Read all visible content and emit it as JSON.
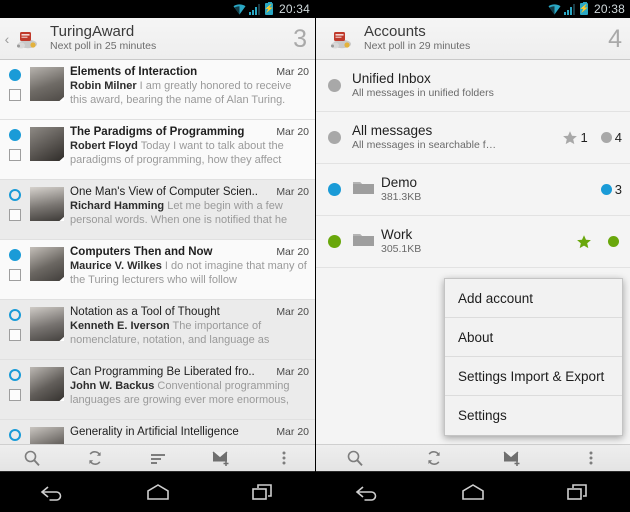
{
  "left": {
    "statusbar": {
      "time": "20:34",
      "wifi_icon": "wifi-icon",
      "signal_icon": "signal-icon",
      "battery_icon": "battery-charging-icon"
    },
    "actionbar": {
      "back_icon": "back-chevron-icon",
      "app_icon": "k9-mail-dog-icon",
      "title": "TuringAward",
      "subtitle": "Next poll in 25 minutes",
      "count": "3"
    },
    "messages": [
      {
        "subject": "Elements of Interaction",
        "date": "Mar 20",
        "sender": "Robin Milner",
        "preview": "I am greatly honored to receive this award, bearing the name of Alan Turing.",
        "unread": true
      },
      {
        "subject": "The Paradigms of Programming",
        "date": "Mar 20",
        "sender": "Robert Floyd",
        "preview": "Today I want to talk about the paradigms of programming, how they affect",
        "unread": true
      },
      {
        "subject": "One Man's View of Computer Scien..",
        "date": "Mar 20",
        "sender": "Richard Hamming",
        "preview": "Let me begin with a few personal words. When one is notified that he",
        "unread": false
      },
      {
        "subject": "Computers Then and Now",
        "date": "Mar 20",
        "sender": "Maurice V. Wilkes",
        "preview": "I do not imagine that many of the Turing lecturers who will follow",
        "unread": true
      },
      {
        "subject": "Notation as a Tool of Thought",
        "date": "Mar 20",
        "sender": "Kenneth E. Iverson",
        "preview": "The importance of nomenclature, notation, and language as",
        "unread": false
      },
      {
        "subject": "Can Programming Be Liberated fro..",
        "date": "Mar 20",
        "sender": "John W. Backus",
        "preview": "Conventional programming languages are growing ever more enormous,",
        "unread": false
      },
      {
        "subject": "Generality in Artificial Intelligence",
        "date": "Mar 20",
        "sender": "",
        "preview": "",
        "unread": false
      }
    ],
    "toolbar": [
      {
        "icon": "search-icon",
        "label": "Search"
      },
      {
        "icon": "refresh-icon",
        "label": "Refresh"
      },
      {
        "icon": "sort-icon",
        "label": "Sort"
      },
      {
        "icon": "compose-icon",
        "label": "Compose"
      },
      {
        "icon": "overflow-menu-icon",
        "label": "More options"
      }
    ]
  },
  "right": {
    "statusbar": {
      "time": "20:38",
      "wifi_icon": "wifi-icon",
      "signal_icon": "signal-icon",
      "battery_icon": "battery-charging-icon"
    },
    "actionbar": {
      "app_icon": "k9-mail-dog-icon",
      "title": "Accounts",
      "subtitle": "Next poll in 29 minutes",
      "count": "4"
    },
    "accounts": [
      {
        "name": "Unified Inbox",
        "sub": "All messages in unified folders",
        "dot_color": "#a8a8a8",
        "has_folder_icon": false,
        "starred": null,
        "unread": null
      },
      {
        "name": "All messages",
        "sub": "All messages in searchable f…",
        "dot_color": "#a8a8a8",
        "has_folder_icon": false,
        "starred": "1",
        "unread": "4",
        "badge_color": "#a8a8a8"
      },
      {
        "name": "Demo",
        "sub": "381.3KB",
        "dot_color": "#1a9bd7",
        "has_folder_icon": true,
        "starred": null,
        "unread": "3",
        "badge_color": "#1a9bd7"
      },
      {
        "name": "Work",
        "sub": "305.1KB",
        "dot_color": "#62a породы"
      }
    ],
    "popup_menu": [
      {
        "label": "Add account"
      },
      {
        "label": "About"
      },
      {
        "label": "Settings Import & Export"
      },
      {
        "label": "Settings"
      }
    ],
    "toolbar": [
      {
        "icon": "search-icon",
        "label": "Search"
      },
      {
        "icon": "refresh-icon",
        "label": "Refresh"
      },
      {
        "icon": "compose-icon",
        "label": "Compose"
      },
      {
        "icon": "overflow-menu-icon",
        "label": "More options"
      }
    ]
  },
  "navbar": [
    {
      "icon": "back-icon",
      "label": "Back"
    },
    {
      "icon": "home-icon",
      "label": "Home"
    },
    {
      "icon": "recents-icon",
      "label": "Recent apps"
    }
  ],
  "colors": {
    "unread_blue": "#1a9bd7",
    "work_green": "#69a70b",
    "neutral_gray": "#a8a8a8",
    "status_accent": "#2aa7c4"
  }
}
